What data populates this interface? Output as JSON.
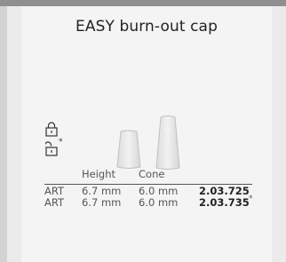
{
  "product": {
    "title": "EASY burn-out cap"
  },
  "legend": {
    "locked_icon": "lock-closed-icon",
    "unlocked_icon": "lock-open-icon",
    "unlocked_mark": "*"
  },
  "table": {
    "columns": [
      "",
      "Height",
      "Cone",
      ""
    ],
    "rows": [
      {
        "type": "ART",
        "height": "6.7 mm",
        "cone": "6.0 mm",
        "code": "2.03.725",
        "mark": ""
      },
      {
        "type": "ART",
        "height": "6.7 mm",
        "cone": "6.0 mm",
        "code": "2.03.735",
        "mark": "*"
      }
    ]
  },
  "colors": {
    "topbar": "#8f8f8f",
    "card": "#f4f4f4",
    "cap_fill": "#e6e6e6",
    "cap_stroke": "#bcbcbc"
  }
}
